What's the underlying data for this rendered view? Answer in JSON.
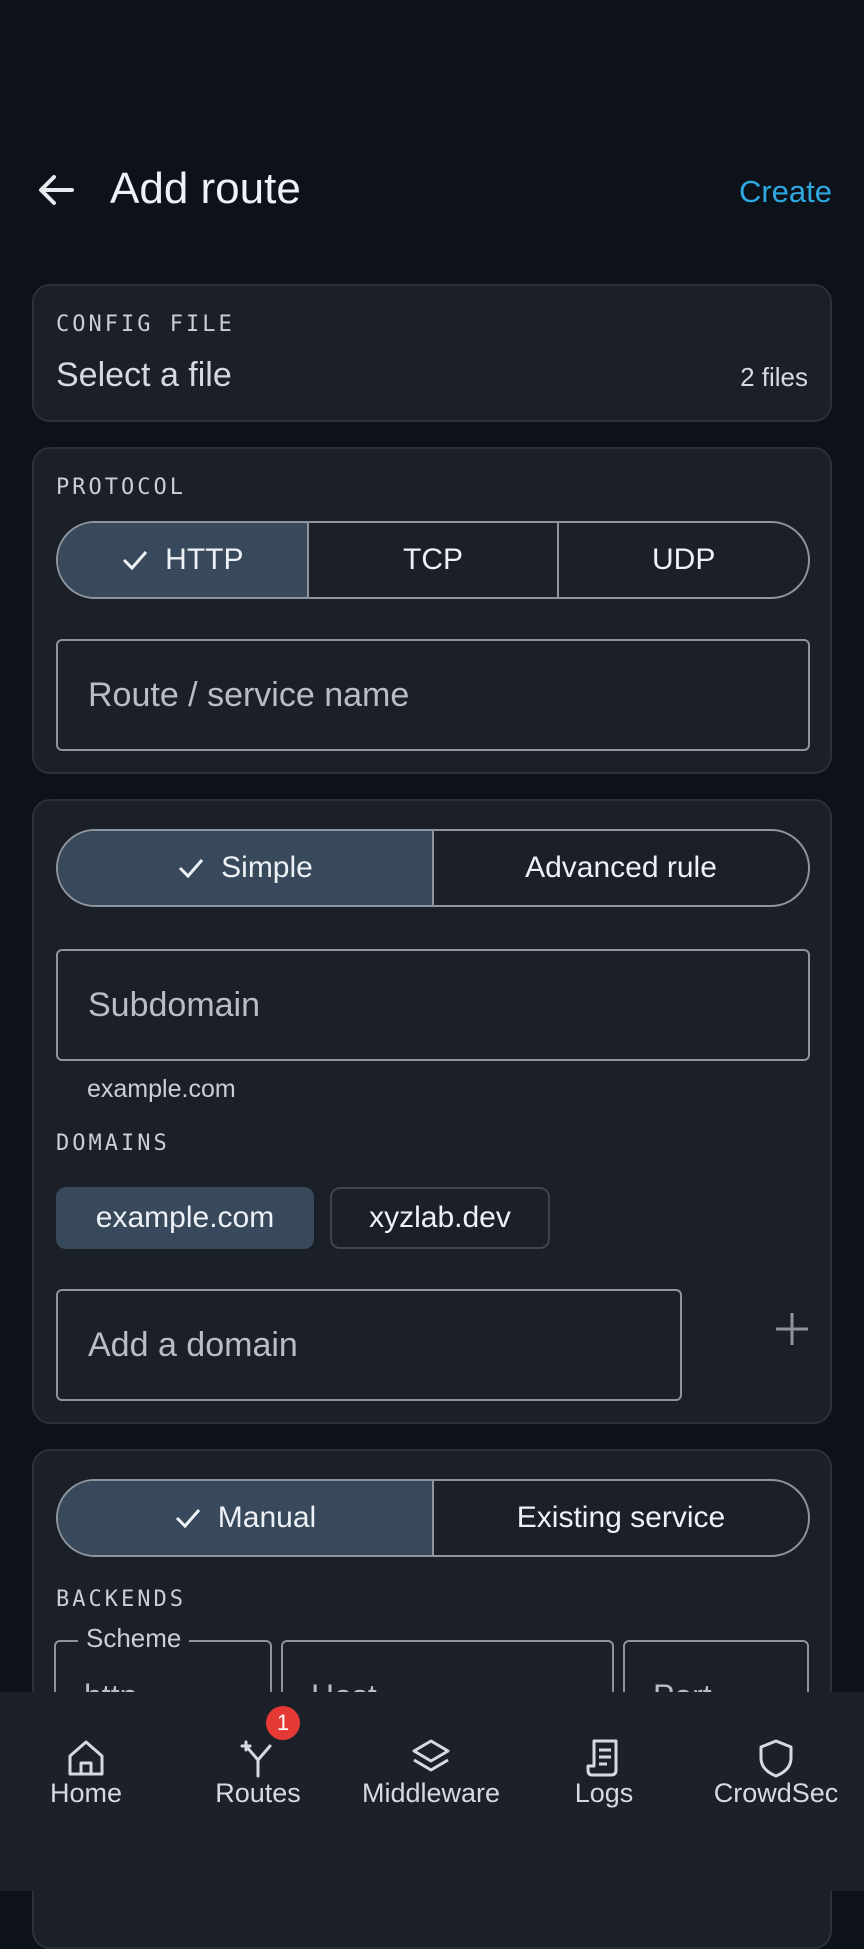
{
  "header": {
    "title": "Add route",
    "create_label": "Create"
  },
  "config": {
    "label": "CONFIG FILE",
    "placeholder": "Select a file",
    "count": "2 files"
  },
  "protocol": {
    "label": "PROTOCOL",
    "options": [
      "HTTP",
      "TCP",
      "UDP"
    ],
    "selected": "HTTP",
    "name_placeholder": "Route / service name"
  },
  "rule": {
    "modes": [
      "Simple",
      "Advanced rule"
    ],
    "selected": "Simple",
    "subdomain_placeholder": "Subdomain",
    "subdomain_hint": "example.com",
    "domains_label": "DOMAINS",
    "domains": [
      "example.com",
      "xyzlab.dev"
    ],
    "add_domain_placeholder": "Add a domain"
  },
  "service": {
    "modes": [
      "Manual",
      "Existing service"
    ],
    "selected": "Manual",
    "backends_label": "BACKENDS",
    "scheme_label": "Scheme",
    "scheme_value": "http",
    "host_placeholder": "Host",
    "port_placeholder": "Port"
  },
  "nav": {
    "items": [
      {
        "label": "Home",
        "icon": "home-icon"
      },
      {
        "label": "Routes",
        "icon": "routes-icon",
        "badge": "1"
      },
      {
        "label": "Middleware",
        "icon": "layers-icon"
      },
      {
        "label": "Logs",
        "icon": "logs-icon"
      },
      {
        "label": "CrowdSec",
        "icon": "shield-icon"
      }
    ]
  },
  "colors": {
    "accent": "#2fa8e0",
    "selected": "#37495a",
    "badge": "#e53935"
  }
}
